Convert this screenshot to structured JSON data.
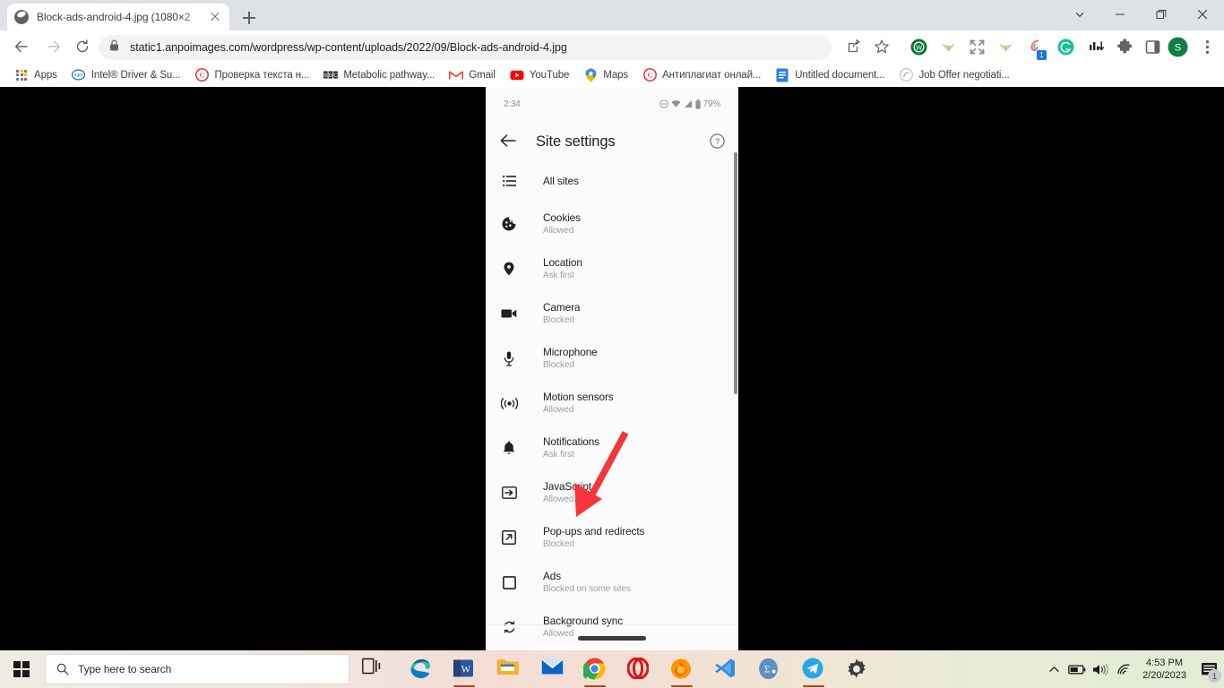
{
  "browser": {
    "tab": {
      "title": "Block-ads-android-4.jpg (1080×2",
      "favicon_name": "globe-favicon"
    },
    "newtab_label": "+",
    "window_controls": {
      "minimize": "minimize",
      "restore": "restore",
      "close": "close",
      "chevron": "chevron-down"
    },
    "omnibox": {
      "url": "static1.anpoimages.com/wordpress/wp-content/uploads/2022/09/Block-ads-android-4.jpg",
      "lock_icon": "padlock-icon"
    },
    "toolbar_icons": [
      {
        "name": "share-icon"
      },
      {
        "name": "bookmark-star-icon"
      },
      {
        "name": "extension-wot-icon",
        "color": "#1a7a3c"
      },
      {
        "name": "extension-horns-icon",
        "color": "#d9cda0"
      },
      {
        "name": "extension-fullscreen-icon",
        "color": "#8a8a8a"
      },
      {
        "name": "extension-horns-2-icon",
        "color": "#d9cda0"
      },
      {
        "name": "extension-colorpick-icon",
        "color": "#f06292",
        "badge": "1"
      },
      {
        "name": "extension-grammarly-icon",
        "color": "#15c39a"
      },
      {
        "name": "extension-equalizer-icon",
        "color": "#202124"
      },
      {
        "name": "extensions-puzzle-icon",
        "color": "#5f6368"
      },
      {
        "name": "side-panel-icon",
        "color": "#5f6368"
      },
      {
        "name": "profile-avatar",
        "color": "#0f8043",
        "letter": "S"
      },
      {
        "name": "chrome-menu-icon",
        "color": "#5f6368"
      }
    ],
    "bookmarks": [
      {
        "label": "Apps",
        "icon": "apps-grid-icon"
      },
      {
        "label": "Intel® Driver & Su...",
        "icon": "intel-icon"
      },
      {
        "label": "Проверка текста н...",
        "icon": "copyright-icon"
      },
      {
        "label": "Metabolic pathway...",
        "icon": "bbc-icon"
      },
      {
        "label": "Gmail",
        "icon": "gmail-icon"
      },
      {
        "label": "YouTube",
        "icon": "youtube-icon"
      },
      {
        "label": "Maps",
        "icon": "maps-pin-icon"
      },
      {
        "label": "Антиплагиат онлай...",
        "icon": "copyright-icon"
      },
      {
        "label": "Untitled document...",
        "icon": "google-docs-icon"
      },
      {
        "label": "Job Offer negotiati...",
        "icon": "circle-arrow-icon"
      }
    ]
  },
  "phone": {
    "status": {
      "time": "2:34",
      "battery": "79%",
      "icons": [
        "do-not-disturb-icon",
        "wifi-icon",
        "cellular-signal-icon",
        "battery-icon"
      ]
    },
    "appbar": {
      "back_icon": "back-arrow-icon",
      "title": "Site settings",
      "help_icon": "help-circle-icon"
    },
    "settings": [
      {
        "title": "All sites",
        "sub": "",
        "icon": "list-icon"
      },
      {
        "title": "Cookies",
        "sub": "Allowed",
        "icon": "cookie-icon"
      },
      {
        "title": "Location",
        "sub": "Ask first",
        "icon": "location-pin-icon"
      },
      {
        "title": "Camera",
        "sub": "Blocked",
        "icon": "video-camera-icon"
      },
      {
        "title": "Microphone",
        "sub": "Blocked",
        "icon": "microphone-icon"
      },
      {
        "title": "Motion sensors",
        "sub": "Allowed",
        "icon": "motion-sensor-icon"
      },
      {
        "title": "Notifications",
        "sub": "Ask first",
        "icon": "bell-icon"
      },
      {
        "title": "JavaScript",
        "sub": "Allowed",
        "icon": "javascript-icon"
      },
      {
        "title": "Pop-ups and redirects",
        "sub": "Blocked",
        "icon": "popup-external-link-icon"
      },
      {
        "title": "Ads",
        "sub": "Blocked on some sites",
        "icon": "ads-square-icon"
      },
      {
        "title": "Background sync",
        "sub": "Allowed",
        "icon": "sync-icon"
      }
    ],
    "annotation": {
      "name": "red-arrow-annotation",
      "color": "#f4353a",
      "points_to": "Pop-ups and redirects"
    }
  },
  "taskbar": {
    "start_icon": "windows-start-icon",
    "search_placeholder": "Type here to search",
    "search_value": "",
    "search_icon": "search-magnifier-icon",
    "apps": [
      {
        "name": "task-view-icon",
        "color": "#1b1b1b",
        "running": false
      },
      {
        "name": "edge-icon",
        "color": "#0e7ec1",
        "running": false
      },
      {
        "name": "word-icon",
        "color": "#2b579a",
        "running": true,
        "underline": "#c43e1c"
      },
      {
        "name": "file-explorer-icon",
        "color": "#f5b324",
        "running": false
      },
      {
        "name": "mail-icon",
        "color": "#0a64c2",
        "running": false
      },
      {
        "name": "chrome-icon",
        "color": "#4285f4",
        "running": true,
        "underline": "#c43e1c"
      },
      {
        "name": "opera-icon",
        "color": "#e0131a",
        "running": false
      },
      {
        "name": "firefox-icon",
        "color": "#ff7139",
        "running": true,
        "underline": "#c43e1c"
      },
      {
        "name": "vscode-icon",
        "color": "#1f9cf0",
        "running": false
      },
      {
        "name": "mendeley-icon",
        "color": "#4a7fb5",
        "running": false
      },
      {
        "name": "telegram-icon",
        "color": "#2ca5e0",
        "running": true,
        "underline": "#c43e1c"
      },
      {
        "name": "settings-gear-icon",
        "color": "#3b3b3b",
        "running": false
      }
    ],
    "tray": {
      "chevron_icon": "show-hidden-icons-chevron",
      "battery_icon": "battery-tray-icon",
      "volume_icon": "volume-tray-icon",
      "network_icon": "wifi-tray-icon",
      "time": "4:53 PM",
      "date": "2/20/2023",
      "notification_icon": "action-center-icon",
      "notification_count": "1"
    }
  }
}
